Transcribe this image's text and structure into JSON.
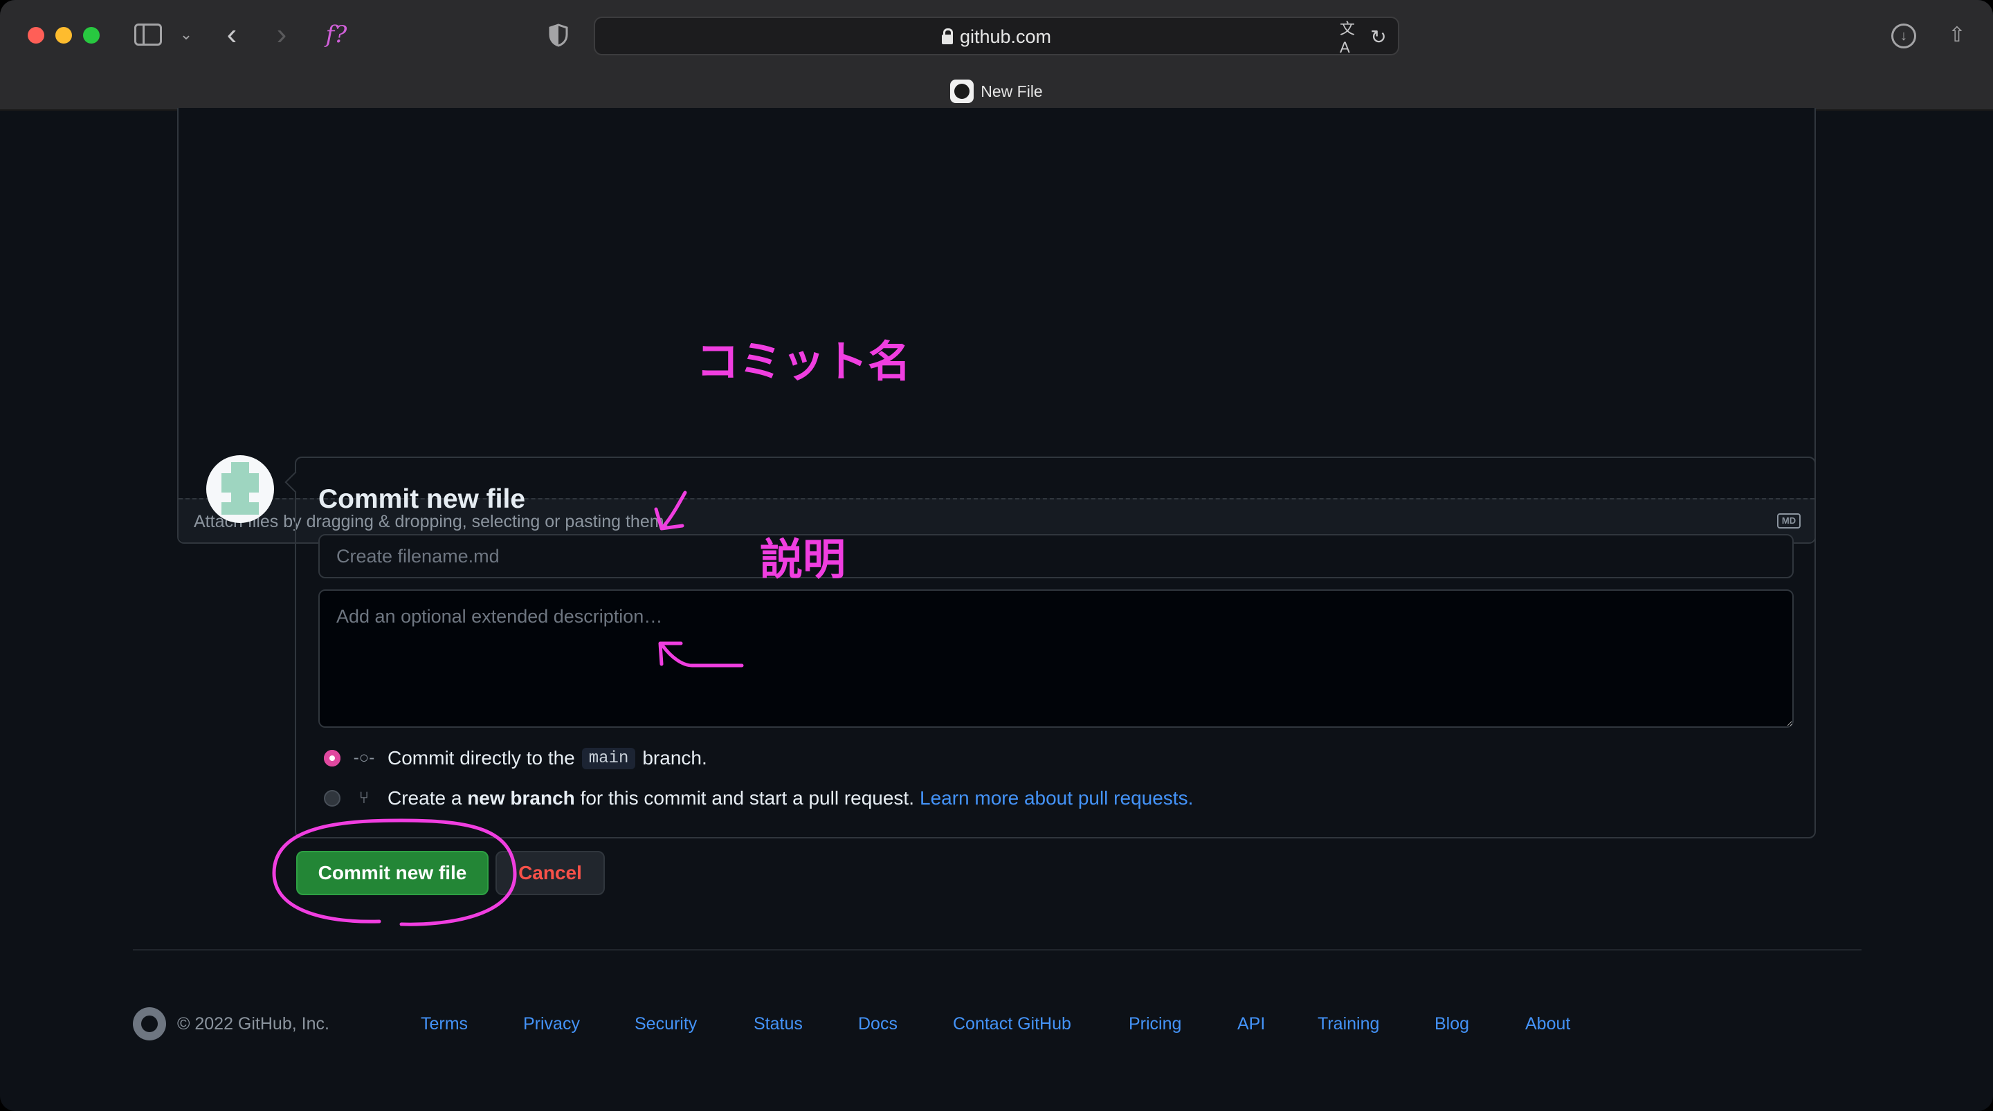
{
  "browser": {
    "url": "github.com",
    "tab_title": "New File",
    "icons": [
      "close-dot",
      "minimize-dot",
      "zoom-dot",
      "sidebar-icon",
      "chevron-down-icon",
      "back-icon",
      "forward-icon",
      "extension-icon",
      "shield-icon",
      "lock-icon",
      "translate-icon",
      "reload-icon",
      "download-icon",
      "share-icon"
    ]
  },
  "editor": {
    "attach_text": "Attach files by dragging & dropping, selecting or pasting them.",
    "markdown_badge": "MD"
  },
  "commit": {
    "title": "Commit new file",
    "summary_placeholder": "Create filename.md",
    "description_placeholder": "Add an optional extended description…",
    "option_direct": {
      "prefix": "Commit directly to the",
      "branch": "main",
      "suffix": "branch.",
      "selected": true
    },
    "option_new_branch": {
      "prefix": "Create a",
      "bold": "new branch",
      "suffix": "for this commit and start a pull request.",
      "link": "Learn more about pull requests.",
      "selected": false
    },
    "commit_button": "Commit new file",
    "cancel_button": "Cancel"
  },
  "annotations": {
    "commit_name": "コミット名",
    "description": "説明",
    "color": "#f03ee0"
  },
  "footer": {
    "copyright": "© 2022 GitHub, Inc.",
    "links": [
      "Terms",
      "Privacy",
      "Security",
      "Status",
      "Docs",
      "Contact GitHub",
      "Pricing",
      "API",
      "Training",
      "Blog",
      "About"
    ]
  },
  "colors": {
    "accent_green": "#238636",
    "link_blue": "#4493f8",
    "danger_red": "#f85149",
    "background": "#0d1117"
  }
}
